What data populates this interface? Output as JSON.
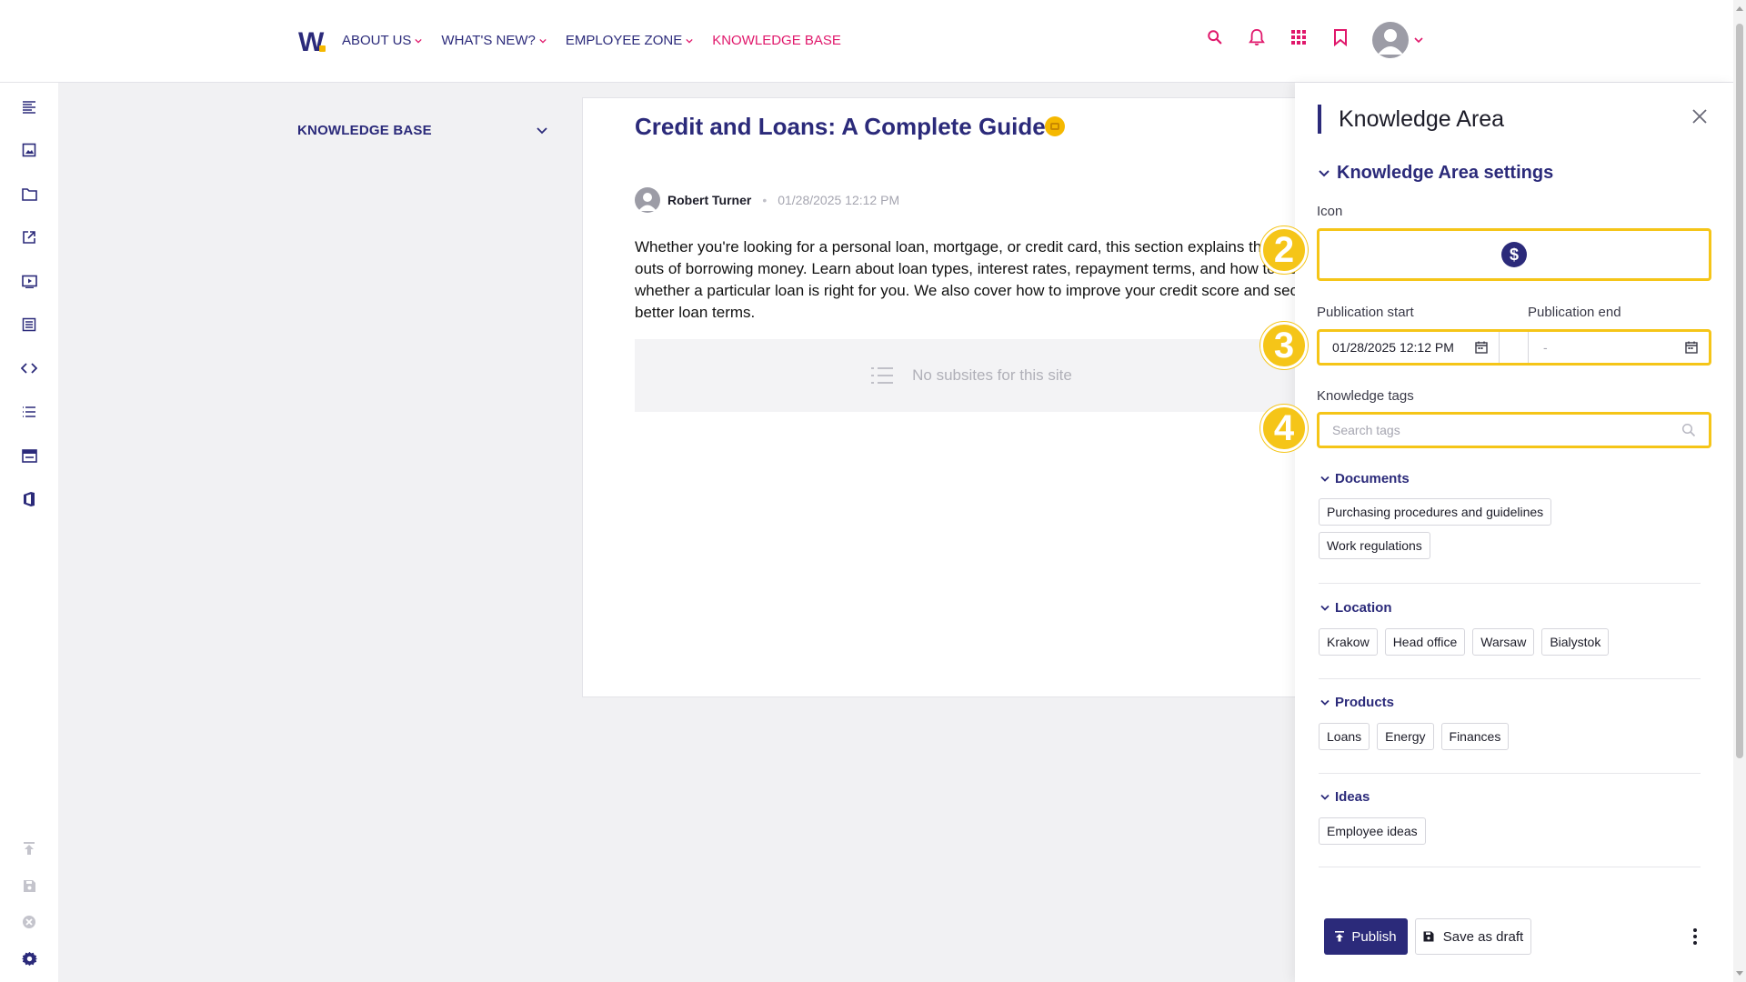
{
  "nav": {
    "logo": "W",
    "items": [
      {
        "label": "ABOUT US",
        "has_dropdown": true
      },
      {
        "label": "WHAT'S NEW?",
        "has_dropdown": true
      },
      {
        "label": "EMPLOYEE ZONE",
        "has_dropdown": true
      },
      {
        "label": "KNOWLEDGE BASE",
        "has_dropdown": false,
        "active": true
      }
    ],
    "icons": [
      "search-icon",
      "bell-icon",
      "apps-grid-icon",
      "bookmark-icon"
    ]
  },
  "rail": {
    "icons": [
      "text-align-icon",
      "image-icon",
      "folder-icon",
      "external-link-icon",
      "video-icon",
      "form-icon",
      "code-icon",
      "list-icon",
      "layout-icon",
      "office-icon",
      "upload-icon",
      "save-icon",
      "close-circle-icon",
      "settings-icon"
    ]
  },
  "sidebar": {
    "title": "KNOWLEDGE BASE"
  },
  "article": {
    "title": "Credit and Loans: A Complete Guide",
    "author": "Robert Turner",
    "date": "01/28/2025 12:12 PM",
    "description": "Whether you're looking for a personal loan, mortgage, or credit card, this section explains the ins and outs of borrowing money. Learn about loan types, interest rates, repayment terms, and how to decide whether a particular loan is right for you. We also cover how to improve your credit score and secure better loan terms.",
    "subsites_empty": "No subsites for this site"
  },
  "panel": {
    "title": "Knowledge Area",
    "settings_label": "Knowledge Area settings",
    "icon_label": "Icon",
    "icon_symbol": "$",
    "pub_start_label": "Publication start",
    "pub_end_label": "Publication end",
    "pub_start_value": "01/28/2025 12:12 PM",
    "pub_end_value": "-",
    "tags_label": "Knowledge tags",
    "tags_placeholder": "Search tags",
    "step_badges": [
      "2",
      "3",
      "4"
    ],
    "groups": [
      {
        "name": "Documents",
        "tags": [
          "Purchasing procedures and guidelines",
          "Work regulations"
        ]
      },
      {
        "name": "Location",
        "tags": [
          "Krakow",
          "Head office",
          "Warsaw",
          "Bialystok"
        ]
      },
      {
        "name": "Products",
        "tags": [
          "Loans",
          "Energy",
          "Finances"
        ]
      },
      {
        "name": "Ideas",
        "tags": [
          "Employee ideas"
        ]
      }
    ],
    "publish_label": "Publish",
    "draft_label": "Save as draft"
  },
  "colors": {
    "brand": "#2b2a7a",
    "accent": "#e0176b",
    "highlight": "#f5c518"
  }
}
